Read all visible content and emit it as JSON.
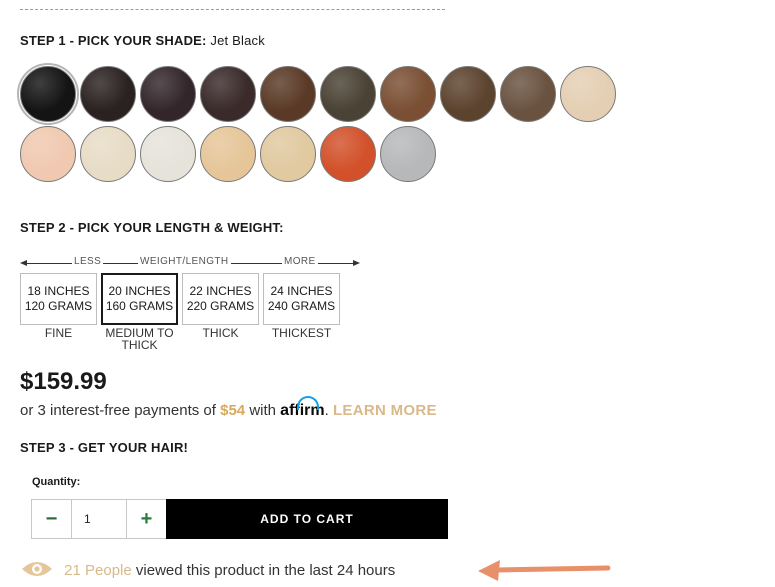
{
  "step1": {
    "title": "STEP 1 - PICK YOUR SHADE:",
    "selected_shade": "Jet Black"
  },
  "swatch_rows": [
    [
      "#141414",
      "#2a2221",
      "#33262a",
      "#3a2a2a",
      "#5a3a26",
      "#4a4234",
      "#7a4f33",
      "#5c432e",
      "#6a5240",
      "#e5cfb4"
    ],
    [
      "#f0c9b0",
      "#e7dcc6",
      "#e6e3db",
      "#e6c699",
      "#e1c9a0",
      "#d2512a",
      "#b7b8b9"
    ]
  ],
  "step2": {
    "title": "STEP 2 - PICK YOUR LENGTH & WEIGHT:"
  },
  "weight_scale": {
    "less": "LESS",
    "middle": "WEIGHT/LENGTH",
    "more": "MORE"
  },
  "length_options": [
    {
      "line1": "18 INCHES",
      "line2": "120 GRAMS",
      "desc": "FINE",
      "selected": false
    },
    {
      "line1": "20 INCHES",
      "line2": "160 GRAMS",
      "desc": "MEDIUM TO THICK",
      "selected": true
    },
    {
      "line1": "22 INCHES",
      "line2": "220 GRAMS",
      "desc": "THICK",
      "selected": false
    },
    {
      "line1": "24 INCHES",
      "line2": "240 GRAMS",
      "desc": "THICKEST",
      "selected": false
    }
  ],
  "price": "$159.99",
  "affirm": {
    "prefix": "or 3 interest-free payments of",
    "amount": "$54",
    "with": "with",
    "logo": "affirm",
    "learn_more": "LEARN MORE"
  },
  "step3": {
    "title": "STEP 3 - GET YOUR HAIR!"
  },
  "quantity": {
    "label": "Quantity:",
    "value": "1",
    "minus": "−",
    "plus": "+"
  },
  "add_to_cart": "ADD TO CART",
  "viewers": {
    "count": "21 People",
    "text": "viewed this product in the last 24 hours"
  },
  "colors": {
    "accent_gold": "#d9b98a",
    "annotation_arrow": "#e8906a",
    "affirm_blue": "#0fa0ea"
  }
}
